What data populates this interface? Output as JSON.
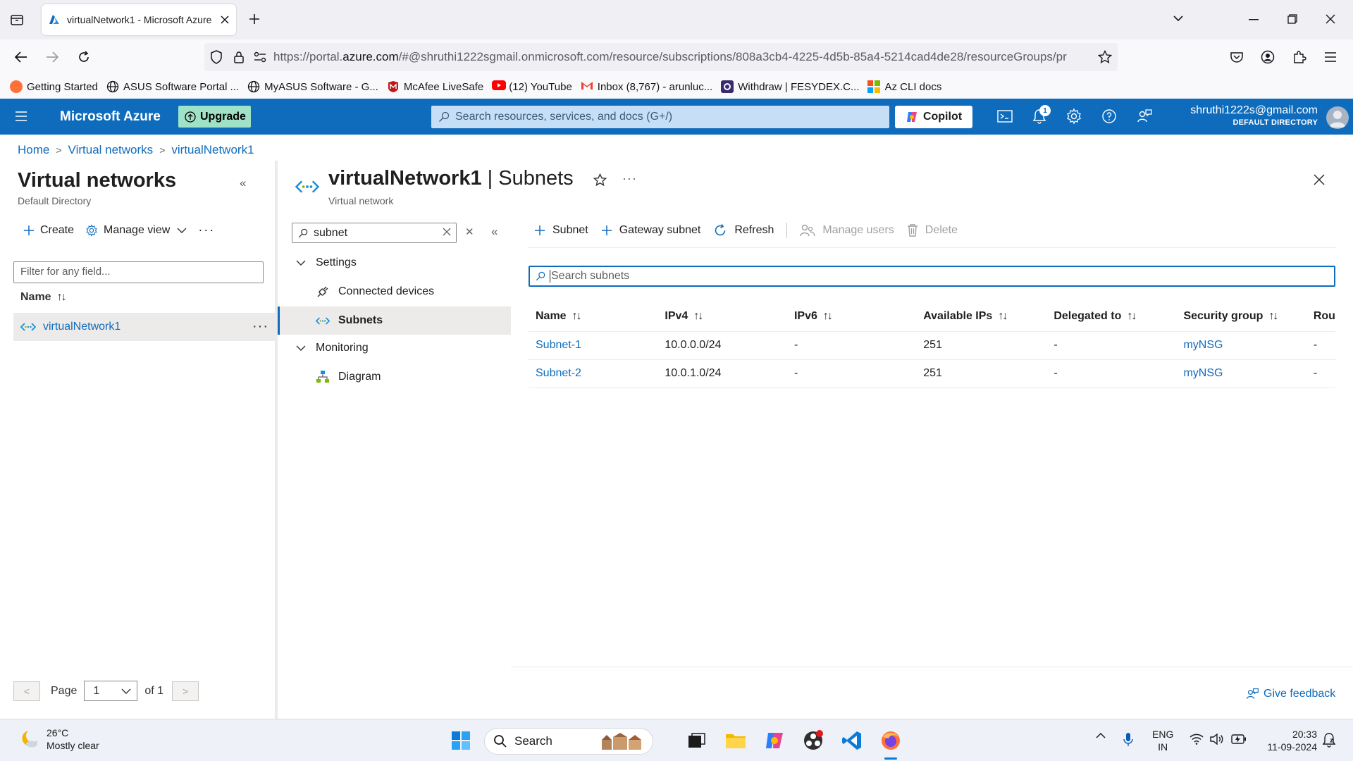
{
  "browser": {
    "tab_title": "virtualNetwork1 - Microsoft Azure",
    "url_prefix": "https://portal.",
    "url_domain": "azure.com",
    "url_rest": "/#@shruthi1222sgmail.onmicrosoft.com/resource/subscriptions/808a3cb4-4225-4d5b-85a4-5214cad4de28/resourceGroups/pr",
    "bookmarks": [
      {
        "label": "Getting Started",
        "color": "#ff7139"
      },
      {
        "label": "ASUS Software Portal ...",
        "color": "#5b5b66"
      },
      {
        "label": "MyASUS Software - G...",
        "color": "#5b5b66"
      },
      {
        "label": "McAfee LiveSafe",
        "color": "#c01818"
      },
      {
        "label": "(12) YouTube",
        "color": "#ff0000"
      },
      {
        "label": "Inbox (8,767) - arunluc...",
        "color": "#ea4335"
      },
      {
        "label": "Withdraw | FESYDEX.C...",
        "color": "#3a2a6e"
      },
      {
        "label": "Az CLI docs",
        "color": "#f25022"
      }
    ]
  },
  "azure": {
    "brand": "Microsoft Azure",
    "upgrade": "Upgrade",
    "search_placeholder": "Search resources, services, and docs (G+/)",
    "copilot": "Copilot",
    "notification_count": "1",
    "user_email": "shruthi1222s@gmail.com",
    "user_directory": "DEFAULT DIRECTORY",
    "accent": "#0f6cbd"
  },
  "breadcrumb": [
    "Home",
    "Virtual networks",
    "virtualNetwork1"
  ],
  "left_panel": {
    "title": "Virtual networks",
    "subtitle": "Default Directory",
    "create": "Create",
    "manage_view": "Manage view",
    "filter_placeholder": "Filter for any field...",
    "column_name": "Name",
    "rows": [
      "virtualNetwork1"
    ],
    "pager": {
      "page_label": "Page",
      "page": "1",
      "of_label": "of 1",
      "prev": "<",
      "next": ">"
    }
  },
  "resource": {
    "name": "virtualNetwork1",
    "section": "Subnets",
    "separator": "|",
    "type": "Virtual network"
  },
  "menu": {
    "search_value": "subnet",
    "groups": [
      {
        "label": "Settings",
        "items": [
          "Connected devices",
          "Subnets"
        ]
      },
      {
        "label": "Monitoring",
        "items": [
          "Diagram"
        ]
      }
    ]
  },
  "toolbar": {
    "subnet": "Subnet",
    "gateway_subnet": "Gateway subnet",
    "refresh": "Refresh",
    "manage_users": "Manage users",
    "delete": "Delete"
  },
  "subnets": {
    "search_placeholder": "Search subnets",
    "columns": [
      "Name",
      "IPv4",
      "IPv6",
      "Available IPs",
      "Delegated to",
      "Security group",
      "Rou"
    ],
    "rows": [
      [
        "Subnet-1",
        "10.0.0.0/24",
        "-",
        "251",
        "-",
        "myNSG",
        "-"
      ],
      [
        "Subnet-2",
        "10.0.1.0/24",
        "-",
        "251",
        "-",
        "myNSG",
        "-"
      ]
    ]
  },
  "feedback": "Give feedback",
  "taskbar": {
    "temperature": "26°C",
    "weather": "Mostly clear",
    "search": "Search",
    "lang_top": "ENG",
    "lang_bottom": "IN",
    "time": "20:33",
    "date": "11-09-2024"
  }
}
